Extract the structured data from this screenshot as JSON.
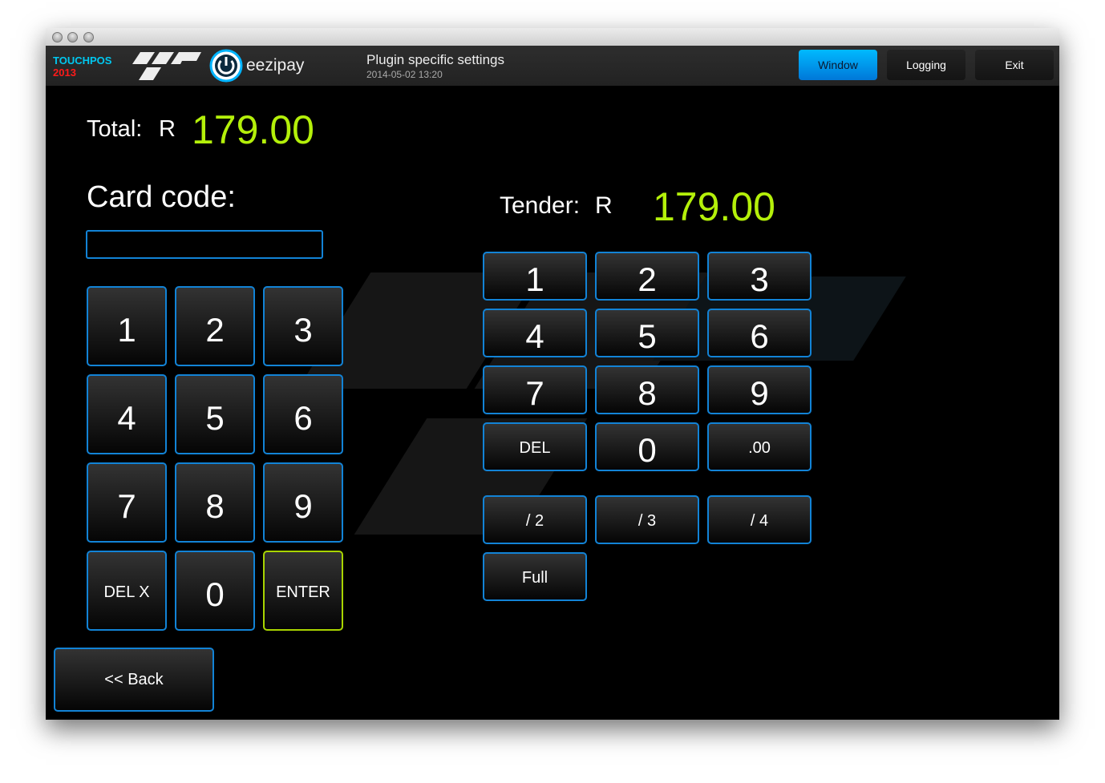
{
  "window": {
    "controls": [
      "close",
      "minimize",
      "zoom"
    ]
  },
  "header": {
    "brand_line1": "TOUCHPOS",
    "brand_line2": "2013",
    "logo_text": "eezipay",
    "title": "Plugin specific settings",
    "timestamp": "2014-05-02 13:20",
    "buttons": [
      {
        "label": "Window",
        "active": true
      },
      {
        "label": "Logging",
        "active": false
      },
      {
        "label": "Exit",
        "active": false
      }
    ]
  },
  "total": {
    "label": "Total:",
    "currency": "R",
    "amount": "179.00"
  },
  "card": {
    "label": "Card code:",
    "value": ""
  },
  "tender": {
    "label": "Tender:",
    "currency": "R",
    "amount": "179.00"
  },
  "left_keypad": [
    "1",
    "2",
    "3",
    "4",
    "5",
    "6",
    "7",
    "8",
    "9",
    "DEL X",
    "0",
    "ENTER"
  ],
  "right_keypad": [
    "1",
    "2",
    "3",
    "4",
    "5",
    "6",
    "7",
    "8",
    "9",
    "DEL",
    "0",
    ".00"
  ],
  "split_buttons": [
    "/ 2",
    "/ 3",
    "/ 4"
  ],
  "full_label": "Full",
  "back_label": "<< Back",
  "colors": {
    "accent": "#1283d6",
    "amount": "#b4f00a",
    "enter_border": "#a8d400",
    "active_tab": "#00a8f0"
  }
}
